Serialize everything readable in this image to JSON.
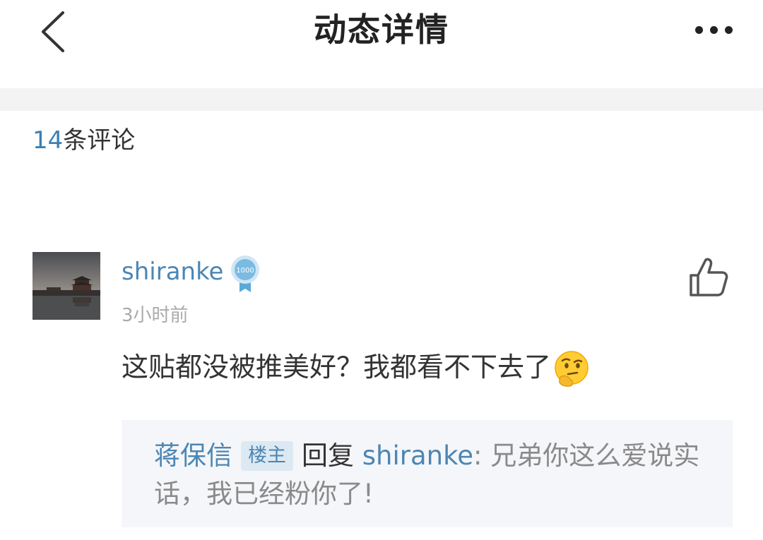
{
  "header": {
    "title": "动态详情"
  },
  "comments_section": {
    "count": "14",
    "count_suffix": "条评论"
  },
  "comment": {
    "username": "shiranke",
    "badge_text": "1000",
    "time": "3小时前",
    "text": "这贴都没被推美好？我都看不下去了",
    "reply": {
      "author": "蒋保信",
      "op_tag": "楼主",
      "verb": "回复",
      "target": "shiranke",
      "colon": ":",
      "body": "兄弟你这么爱说实话，我已经粉你了!"
    }
  },
  "colors": {
    "accent": "#4b86b4",
    "text": "#333333",
    "muted": "#aaaaaa",
    "reply_bg": "#f5f6f9",
    "op_tag_bg": "#dce9f3"
  },
  "icons": {
    "back": "chevron-left-icon",
    "more": "more-dots-icon",
    "like": "thumbs-up-icon",
    "emoji": "thinking-face-emoji",
    "badge": "level-badge-icon"
  }
}
